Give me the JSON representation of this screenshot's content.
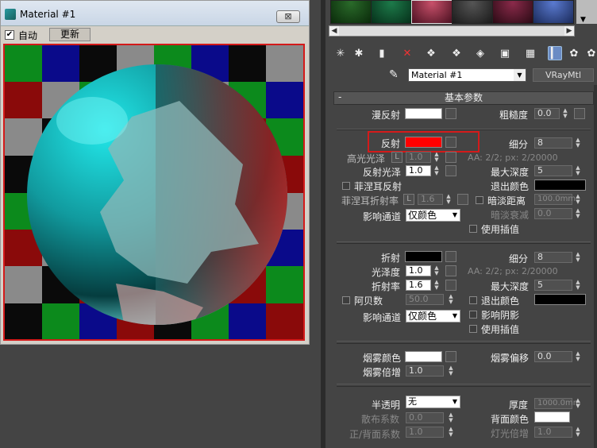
{
  "preview_window": {
    "title": "Material #1",
    "close_label": "⊠",
    "auto_label": "自动",
    "auto_checked": "✔",
    "update_label": "更新"
  },
  "toolbar": {
    "material_name": "Material #1",
    "material_type": "VRayMtl",
    "icons": [
      "get-material-icon",
      "put-to-scene-icon",
      "assign-material-icon",
      "reset-icon",
      "make-copy-icon",
      "make-unique-icon",
      "put-to-library-icon",
      "material-id-icon",
      "show-map-icon",
      "show-background-icon",
      "go-to-parent-icon",
      "go-forward-sibling-icon"
    ]
  },
  "rollout": {
    "title": "基本参数",
    "toggle": "-",
    "diffuse": {
      "label": "漫反射",
      "roughness_label": "粗糙度",
      "roughness": "0.0"
    },
    "reflect": {
      "label": "反射",
      "subdivs_label": "细分",
      "subdivs": "8",
      "hilight_label": "高光光泽",
      "hilight_lock": "L",
      "hilight": "1.0",
      "aa_info": "AA: 2/2; px: 2/20000",
      "refl_gloss_label": "反射光泽",
      "refl_gloss": "1.0",
      "max_depth_label": "最大深度",
      "max_depth": "5",
      "fresnel_label": "菲涅耳反射",
      "exit_color_label": "退出颜色",
      "fresnel_ior_label": "菲涅耳折射率",
      "fresnel_ior_lock": "L",
      "fresnel_ior": "1.6",
      "dim_dist_label": "暗淡距离",
      "dim_dist": "100.0mm",
      "affect_label": "影响通道",
      "affect_value": "仅颜色",
      "dim_falloff_label": "暗淡衰减",
      "dim_falloff": "0.0",
      "interp_label": "使用插值"
    },
    "refract": {
      "label": "折射",
      "subdivs_label": "细分",
      "subdivs": "8",
      "gloss_label": "光泽度",
      "gloss": "1.0",
      "aa_info": "AA: 2/2; px: 2/20000",
      "ior_label": "折射率",
      "ior": "1.6",
      "max_depth_label": "最大深度",
      "max_depth": "5",
      "abbe_label": "阿贝数",
      "abbe": "50.0",
      "exit_color_label": "退出颜色",
      "shadow_label": "影响阴影",
      "affect_label": "影响通道",
      "affect_value": "仅颜色",
      "interp_label": "使用插值"
    },
    "fog": {
      "color_label": "烟雾颜色",
      "bias_label": "烟雾偏移",
      "bias": "0.0",
      "mult_label": "烟雾倍增",
      "mult": "1.0"
    },
    "translucency": {
      "label": "半透明",
      "value": "无",
      "thickness_label": "厚度",
      "thickness": "1000.0mm",
      "scatter_label": "散布系数",
      "scatter": "0.0",
      "back_color_label": "背面颜色",
      "fb_label": "正/背面系数",
      "fb": "1.0",
      "light_mult_label": "灯光倍增",
      "light_mult": "1.0"
    }
  },
  "colors": {
    "highlight_border": "#d41a1a",
    "reflect_swatch": "#ff0000",
    "diffuse_swatch": "#ffffff",
    "refract_swatch": "#000000"
  }
}
